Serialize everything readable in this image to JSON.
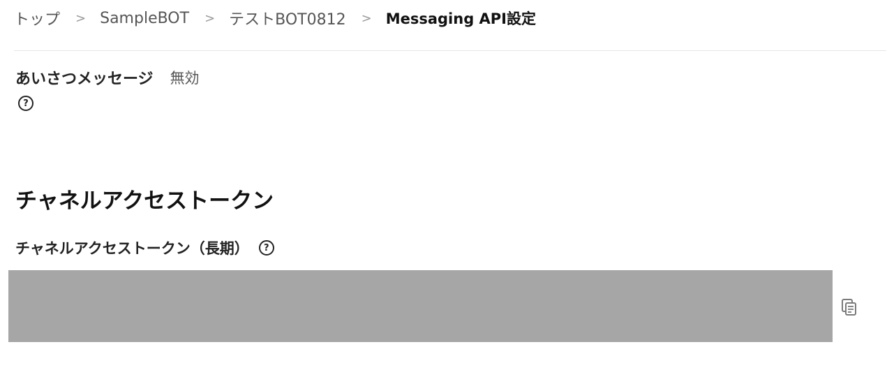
{
  "breadcrumb": {
    "items": [
      "トップ",
      "SampleBOT",
      "テストBOT0812"
    ],
    "current": "Messaging API設定",
    "separator": ">"
  },
  "greeting": {
    "label": "あいさつメッセージ",
    "value": "無効",
    "help_icon": "question-circle-icon"
  },
  "token_section": {
    "title": "チャネルアクセストークン",
    "label": "チャネルアクセストークン（長期）",
    "help_icon": "question-circle-icon",
    "copy_icon": "copy-icon",
    "token_box_color": "#a6a6a6"
  },
  "icons": {
    "help_glyph": "?"
  }
}
